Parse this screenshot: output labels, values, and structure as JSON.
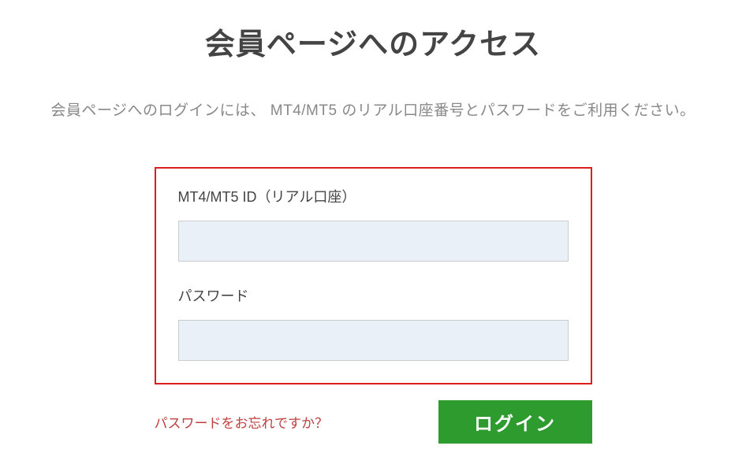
{
  "page_title": "会員ページへのアクセス",
  "instruction": "会員ページへのログインには、 MT4/MT5 のリアル口座番号とパスワードをご利用ください。",
  "form": {
    "id_label": "MT4/MT5 ID（リアル口座）",
    "id_value": "",
    "password_label": "パスワード",
    "password_value": ""
  },
  "forgot_password_label": "パスワードをお忘れですか？",
  "login_button_label": "ログイン",
  "colors": {
    "accent_red": "#dc1e1e",
    "button_green": "#2e9b2e",
    "title_gray": "#444444",
    "text_gray": "#888888",
    "input_bg": "#eaf0f8",
    "link_red": "#c04040"
  }
}
